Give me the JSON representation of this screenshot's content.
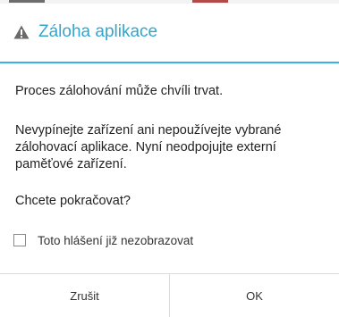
{
  "dialog": {
    "title": "Záloha aplikace",
    "title_color": "#33a6cf",
    "accent_color": "#33b5e5",
    "title_icon": "warning-icon",
    "messages": [
      "Proces zálohování může chvíli trvat.",
      "Nevypínejte zařízení ani nepoužívejte vybrané zálohovací aplikace. Nyní neodpojujte externí paměťové zařízení.",
      "Chcete pokračovat?"
    ],
    "checkbox": {
      "label": "Toto hlášení již nezobrazovat",
      "checked": false
    },
    "buttons": {
      "cancel_label": "Zrušit",
      "ok_label": "OK"
    }
  }
}
